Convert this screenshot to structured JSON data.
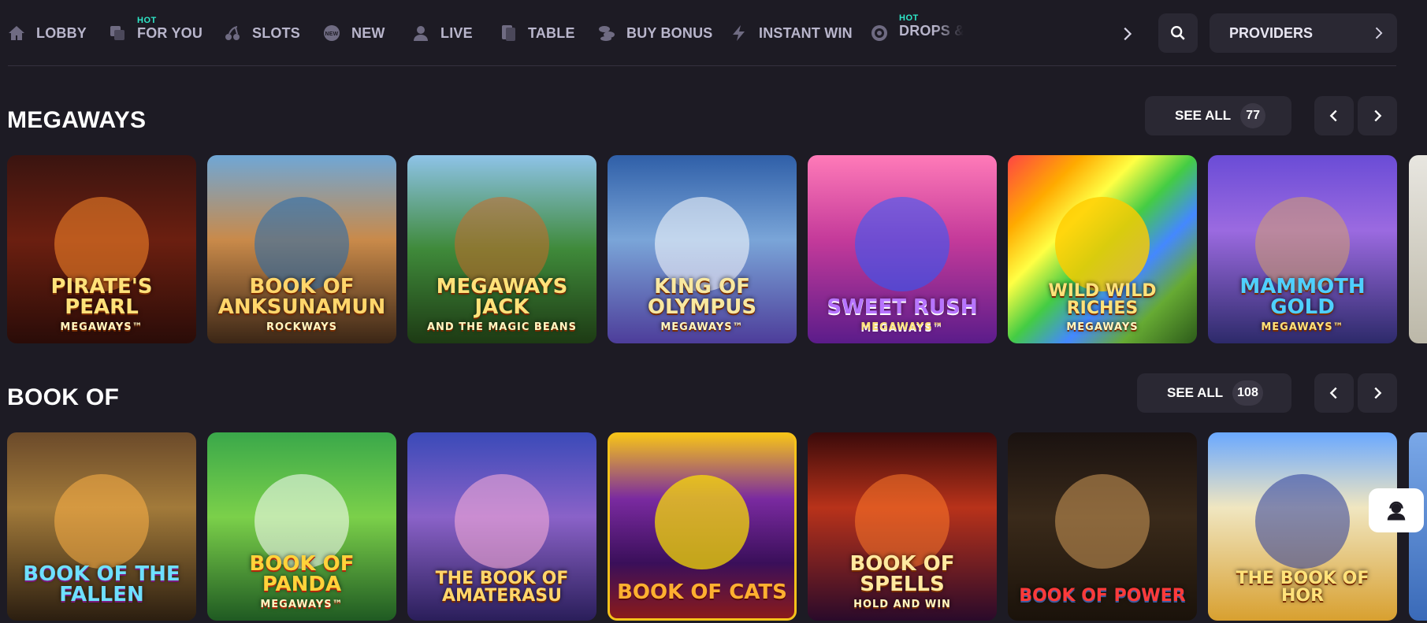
{
  "nav": {
    "items": [
      {
        "label": "LOBBY",
        "icon": "home-icon",
        "hot": ""
      },
      {
        "label": "FOR YOU",
        "icon": "for-you-icon",
        "hot": "HOT"
      },
      {
        "label": "SLOTS",
        "icon": "cherries-icon",
        "hot": ""
      },
      {
        "label": "NEW",
        "icon": "new-badge-icon",
        "hot": ""
      },
      {
        "label": "LIVE",
        "icon": "live-dealer-icon",
        "hot": ""
      },
      {
        "label": "TABLE",
        "icon": "cards-icon",
        "hot": ""
      },
      {
        "label": "BUY BONUS",
        "icon": "coins-icon",
        "hot": ""
      },
      {
        "label": "INSTANT WIN",
        "icon": "lightning-icon",
        "hot": ""
      },
      {
        "label": "DROPS & W",
        "icon": "drops-icon",
        "hot": "HOT"
      }
    ],
    "providers_label": "PROVIDERS"
  },
  "sections": [
    {
      "title": "MEGAWAYS",
      "see_all_label": "SEE ALL",
      "count": "77",
      "games": [
        {
          "name": "PIRATE'S PEARL",
          "sub": "MEGAWAYS™"
        },
        {
          "name": "BOOK OF ANKSUNAMUN",
          "sub": "Rockways"
        },
        {
          "name": "MEGAWAYS JACK",
          "sub": "AND THE MAGIC BEANS"
        },
        {
          "name": "KING OF OLYMPUS",
          "sub": "MEGAWAYS™"
        },
        {
          "name": "SWEET RUSH",
          "sub": "MEGAWAYS™"
        },
        {
          "name": "WILD WILD RICHES",
          "sub": "MEGAWAYS"
        },
        {
          "name": "MAMMOTH GOLD",
          "sub": "MEGAWAYS™"
        }
      ]
    },
    {
      "title": "BOOK OF",
      "see_all_label": "SEE ALL",
      "count": "108",
      "games": [
        {
          "name": "BOOK OF THE FALLEN",
          "sub": ""
        },
        {
          "name": "BOOK OF PANDA",
          "sub": "MEGAWAYS™"
        },
        {
          "name": "THE BOOK OF AMATERASU",
          "sub": ""
        },
        {
          "name": "BOOK OF CATS",
          "sub": ""
        },
        {
          "name": "BOOK OF SPELLS",
          "sub": "HOLD AND WIN"
        },
        {
          "name": "BOOK OF POWER",
          "sub": ""
        },
        {
          "name": "THE BOOK OF HOR",
          "sub": ""
        }
      ]
    }
  ],
  "colors": {
    "background": "#1d1b24",
    "button": "#2a2833",
    "hot_badge": "#2ee7c8",
    "nav_text": "#b9b6cc"
  }
}
